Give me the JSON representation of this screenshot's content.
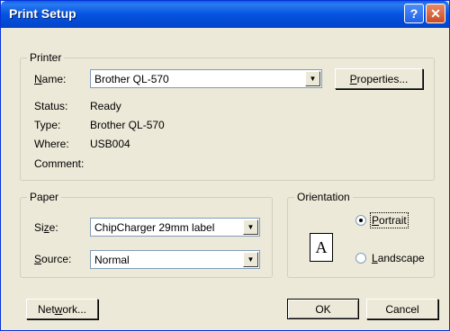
{
  "window": {
    "title": "Print Setup"
  },
  "printer": {
    "legend": "Printer",
    "name_label_u": "N",
    "name_label_rest": "ame:",
    "name_value": "Brother QL-570",
    "properties_u": "P",
    "properties_rest": "roperties...",
    "status_label": "Status:",
    "status_value": "Ready",
    "type_label": "Type:",
    "type_value": "Brother QL-570",
    "where_label": "Where:",
    "where_value": "USB004",
    "comment_label": "Comment:"
  },
  "paper": {
    "legend": "Paper",
    "size_label_pre": "Si",
    "size_label_u": "z",
    "size_label_post": "e:",
    "size_value": "ChipCharger 29mm label",
    "source_label_u": "S",
    "source_label_rest": "ource:",
    "source_value": "Normal"
  },
  "orientation": {
    "legend": "Orientation",
    "portrait_u": "P",
    "portrait_rest": "ortrait",
    "landscape_u": "L",
    "landscape_rest": "andscape",
    "page_letter": "A"
  },
  "buttons": {
    "network_pre": "Net",
    "network_u": "w",
    "network_post": "ork...",
    "ok": "OK",
    "cancel": "Cancel"
  }
}
